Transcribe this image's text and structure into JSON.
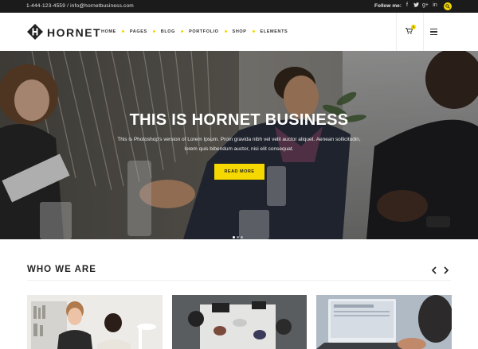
{
  "topbar": {
    "contact": "1-444-123-4559 / info@hornetbusiness.com",
    "follow_label": "Follow me:",
    "socials": [
      {
        "icon": "facebook-icon",
        "glyph": "f"
      },
      {
        "icon": "twitter-icon",
        "glyph": "t"
      },
      {
        "icon": "google-plus-icon",
        "glyph": "g+"
      },
      {
        "icon": "linkedin-icon",
        "glyph": "in"
      }
    ],
    "search_icon": "search-icon",
    "accent": "#f5d800"
  },
  "header": {
    "logo_text": "HORNET",
    "nav": [
      "HOME",
      "PAGES",
      "BLOG",
      "PORTFOLIO",
      "SHOP",
      "ELEMENTS"
    ],
    "cart_icon": "cart-icon",
    "cart_count": "0",
    "menu_icon": "hamburger-icon"
  },
  "hero": {
    "title": "THIS IS HORNET BUSINESS",
    "text": "This is Photoshop's version of Lorem Ipsum. Proin gravida nibh vel velit auctor aliquet. Aenean sollicitudin, lorem quis bibendum auctor, nisi elit consequat.",
    "button": "READ MORE",
    "slide_count": 3,
    "active_slide": 1
  },
  "section": {
    "title": "WHO WE ARE",
    "prev_icon": "chevron-left-icon",
    "next_icon": "chevron-right-icon"
  }
}
